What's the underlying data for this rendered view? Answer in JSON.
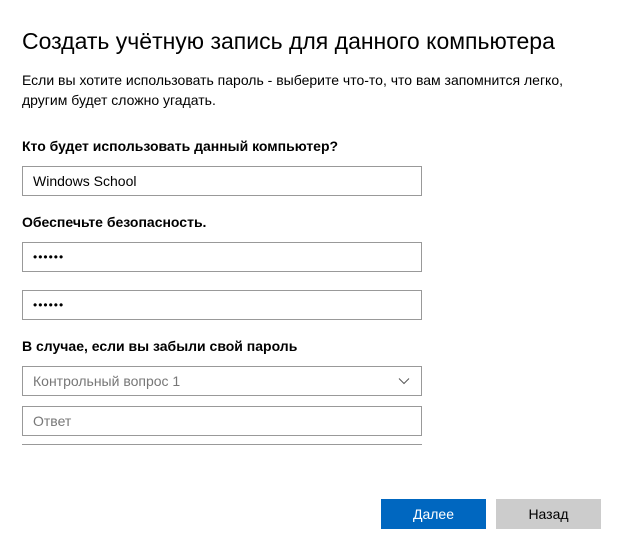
{
  "title": "Создать учётную запись для данного компьютера",
  "subtitle": "Если вы хотите использовать пароль - выберите что-то, что вам запомнится легко, другим будет сложно угадать.",
  "section_user": "Кто будет использовать данный компьютер?",
  "username_value": "Windows School",
  "section_security": "Обеспечьте безопасность.",
  "password_value": "••••••",
  "password_confirm_value": "••••••",
  "section_forgot": "В случае, если вы забыли свой пароль",
  "security_question_placeholder": "Контрольный вопрос 1",
  "answer_placeholder": "Ответ",
  "buttons": {
    "next": "Далее",
    "back": "Назад"
  },
  "colors": {
    "primary": "#0067c0",
    "secondary": "#cccccc"
  }
}
